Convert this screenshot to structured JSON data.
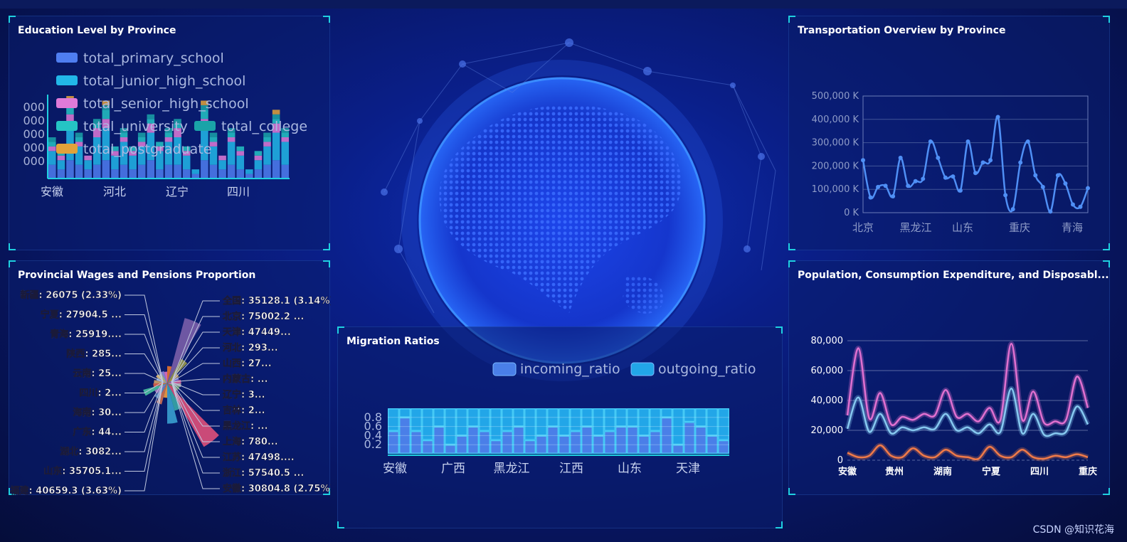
{
  "watermark": "CSDN @知识花海",
  "panels": {
    "education": {
      "title": "Education Level by Province"
    },
    "transport": {
      "title": "Transportation Overview by Province"
    },
    "wages": {
      "title": "Provincial Wages and Pensions Proportion"
    },
    "population": {
      "title": "Population, Consumption Expenditure, and Disposabl..."
    },
    "migration": {
      "title": "Migration Ratios"
    }
  },
  "chart_data": [
    {
      "id": "education",
      "type": "bar",
      "stacked": true,
      "title": "Education Level by Province",
      "legend": [
        "total_primary_school",
        "total_junior_high_school",
        "total_senior_high_school",
        "total_university",
        "total_college",
        "total_postgraduate"
      ],
      "legend_colors": [
        "#4f7ef0",
        "#22b7e8",
        "#e07ad8",
        "#25c4c4",
        "#1aa3a8",
        "#e2a23a"
      ],
      "x_tick_labels": [
        "安徽",
        "河北",
        "辽宁",
        "四川"
      ],
      "y_tick_labels": [
        "000",
        "000",
        "000",
        "000",
        "000"
      ],
      "grid": false,
      "legend_position": "top-left overlapping plot",
      "series": [
        {
          "name": "total_primary_school",
          "values": [
            3,
            2,
            4,
            3,
            2,
            3,
            4,
            2,
            3,
            2,
            3,
            4,
            2,
            3,
            3,
            2,
            1,
            4,
            3,
            2,
            3,
            2,
            1,
            2,
            3,
            4,
            3
          ]
        },
        {
          "name": "total_junior_high_school",
          "values": [
            3,
            2,
            8,
            4,
            2,
            6,
            7,
            3,
            5,
            3,
            4,
            6,
            4,
            5,
            6,
            3,
            1,
            7,
            4,
            2,
            5,
            3,
            1,
            2,
            4,
            6,
            5
          ]
        },
        {
          "name": "total_senior_high_school",
          "values": [
            1,
            1,
            2,
            1,
            1,
            2,
            2,
            1,
            1,
            1,
            1,
            2,
            1,
            1,
            2,
            1,
            0,
            2,
            1,
            1,
            1,
            1,
            0,
            1,
            1,
            2,
            1
          ]
        },
        {
          "name": "total_university",
          "values": [
            1,
            1,
            2,
            1,
            0,
            1,
            2,
            1,
            1,
            1,
            1,
            1,
            1,
            1,
            1,
            1,
            0,
            2,
            1,
            0,
            1,
            1,
            0,
            1,
            1,
            1,
            1
          ]
        },
        {
          "name": "total_college",
          "values": [
            1,
            0,
            1,
            1,
            0,
            1,
            1,
            0,
            1,
            0,
            1,
            1,
            0,
            1,
            1,
            0,
            0,
            1,
            1,
            0,
            1,
            0,
            0,
            0,
            1,
            1,
            1
          ]
        },
        {
          "name": "total_postgraduate",
          "values": [
            0,
            0,
            1,
            0,
            0,
            0,
            1,
            0,
            0,
            0,
            0,
            0,
            0,
            0,
            0,
            0,
            0,
            1,
            0,
            0,
            0,
            0,
            0,
            0,
            0,
            1,
            0
          ]
        }
      ]
    },
    {
      "id": "transport",
      "type": "line",
      "title": "Transportation Overview by Province",
      "x_tick_labels": [
        "北京",
        "黑龙江",
        "山东",
        "重庆",
        "青海"
      ],
      "y_tick_labels": [
        "0 K",
        "100,000 K",
        "200,000 K",
        "300,000 K",
        "400,000 K",
        "500,000 K"
      ],
      "ylim": [
        0,
        500000
      ],
      "grid": true,
      "color": "#4f8ff5",
      "values": [
        225000,
        65000,
        110000,
        115000,
        70000,
        235000,
        115000,
        135000,
        145000,
        305000,
        235000,
        150000,
        155000,
        95000,
        305000,
        170000,
        215000,
        225000,
        410000,
        75000,
        15000,
        215000,
        305000,
        160000,
        110000,
        5000,
        160000,
        125000,
        35000,
        25000,
        105000
      ]
    },
    {
      "id": "wages",
      "type": "pie",
      "subtype": "rose",
      "title": "Provincial Wages and Pensions Proportion",
      "left_labels": [
        "新疆: 26075 (2.33%)",
        "宁夏: 27904.5 ...",
        "青海: 25919....",
        "陕西: 285...",
        "云南: 25...",
        "四川: 2...",
        "海南: 30...",
        "广东: 44...",
        "湖北: 3082...",
        "山东: 35705.1...",
        "福建: 40659.3 (3.63%)"
      ],
      "right_labels": [
        "全国: 35128.1 (3.14%)",
        "北京: 75002.2 ...",
        "天津: 47449...",
        "河北: 293...",
        "山西: 27...",
        "内蒙古: ...",
        "辽宁: 3...",
        "吉林: 2...",
        "黑龙江: ...",
        "上海: 780...",
        "江苏: 47498....",
        "浙江: 57540.5 ...",
        "安徽: 30804.8 (2.75%)"
      ],
      "slices": [
        {
          "name": "全国",
          "value": 35128.1,
          "color": "#e8732c"
        },
        {
          "name": "北京",
          "value": 75002.2,
          "color": "#7a5ea8"
        },
        {
          "name": "天津",
          "value": 47449,
          "color": "#9a9a4a"
        },
        {
          "name": "河北",
          "value": 29300,
          "color": "#c79a3a"
        },
        {
          "name": "山西",
          "value": 27000,
          "color": "#7a7ad8"
        },
        {
          "name": "内蒙古",
          "value": 30000,
          "color": "#d85c9a"
        },
        {
          "name": "辽宁",
          "value": 30000,
          "color": "#b4b4b4"
        },
        {
          "name": "吉林",
          "value": 28000,
          "color": "#60a060"
        },
        {
          "name": "黑龙江",
          "value": 26000,
          "color": "#d86060"
        },
        {
          "name": "上海",
          "value": 78000,
          "color": "#e0507a"
        },
        {
          "name": "江苏",
          "value": 47498,
          "color": "#38a8a8"
        },
        {
          "name": "浙江",
          "value": 57540.5,
          "color": "#3aa0d0"
        },
        {
          "name": "安徽",
          "value": 30804.8,
          "color": "#f0a040"
        },
        {
          "name": "福建",
          "value": 40659.3,
          "color": "#d07050"
        },
        {
          "name": "山东",
          "value": 35705.1,
          "color": "#5a90c8"
        },
        {
          "name": "湖北",
          "value": 30820,
          "color": "#a878c8"
        },
        {
          "name": "广东",
          "value": 44000,
          "color": "#48c0a0"
        },
        {
          "name": "海南",
          "value": 30000,
          "color": "#e06048"
        },
        {
          "name": "四川",
          "value": 29000,
          "color": "#d0a068"
        },
        {
          "name": "云南",
          "value": 25000,
          "color": "#8ab0e0"
        },
        {
          "name": "陕西",
          "value": 28500,
          "color": "#e8c070"
        },
        {
          "name": "青海",
          "value": 25919,
          "color": "#a8c888"
        },
        {
          "name": "宁夏",
          "value": 27904.5,
          "color": "#9088d8"
        },
        {
          "name": "新疆",
          "value": 26075,
          "color": "#e070c0"
        }
      ]
    },
    {
      "id": "population",
      "type": "line",
      "title": "Population, Consumption Expenditure, and Disposabl...",
      "x_tick_labels": [
        "安徽",
        "贵州",
        "湖南",
        "宁夏",
        "四川",
        "重庆"
      ],
      "y_tick_labels": [
        "0",
        "20,000",
        "40,000",
        "60,000",
        "80,000"
      ],
      "ylim": [
        0,
        80000
      ],
      "grid": true,
      "series": [
        {
          "values": [
            30000,
            75000,
            28000,
            45000,
            24000,
            29000,
            27000,
            31000,
            30000,
            47000,
            29000,
            31000,
            26000,
            35000,
            27000,
            78000,
            27000,
            46000,
            25000,
            26000,
            27000,
            56000,
            35000
          ],
          "color": "#e070d0"
        },
        {
          "values": [
            21000,
            42000,
            19000,
            31000,
            18000,
            22000,
            20000,
            22000,
            21000,
            31000,
            20000,
            22000,
            18000,
            24000,
            19000,
            48000,
            18000,
            31000,
            17000,
            18000,
            19000,
            36000,
            24000
          ],
          "color": "#86c8f0"
        },
        {
          "values": [
            5000,
            2000,
            3000,
            10000,
            3000,
            2000,
            8000,
            3000,
            2000,
            7000,
            3000,
            2000,
            1000,
            9000,
            3000,
            2000,
            7000,
            2000,
            1000,
            3000,
            2000,
            4000,
            2000
          ],
          "color": "#f07a48"
        }
      ]
    },
    {
      "id": "migration",
      "type": "bar",
      "stacked": true,
      "title": "Migration Ratios",
      "legend": [
        "incoming_ratio",
        "outgoing_ratio"
      ],
      "legend_colors": [
        "#4a7fe8",
        "#22a6e8"
      ],
      "x_tick_labels": [
        "安徽",
        "广西",
        "黑龙江",
        "江西",
        "山东",
        "天津"
      ],
      "y_tick_labels": [
        "0.2",
        "0.4",
        "0.6",
        "0.8"
      ],
      "grid": true,
      "series": [
        {
          "name": "incoming_ratio",
          "values": [
            0.5,
            0.8,
            0.5,
            0.3,
            0.6,
            0.2,
            0.4,
            0.6,
            0.5,
            0.3,
            0.5,
            0.6,
            0.3,
            0.4,
            0.6,
            0.4,
            0.5,
            0.6,
            0.4,
            0.5,
            0.6,
            0.6,
            0.4,
            0.5,
            0.8,
            0.2,
            0.7,
            0.6,
            0.4,
            0.3
          ]
        },
        {
          "name": "outgoing_ratio",
          "values": [
            0.5,
            0.2,
            0.5,
            0.7,
            0.4,
            0.8,
            0.6,
            0.4,
            0.5,
            0.7,
            0.5,
            0.4,
            0.7,
            0.6,
            0.4,
            0.6,
            0.5,
            0.4,
            0.6,
            0.5,
            0.4,
            0.4,
            0.6,
            0.5,
            0.2,
            0.8,
            0.3,
            0.4,
            0.6,
            0.7
          ]
        }
      ]
    }
  ]
}
